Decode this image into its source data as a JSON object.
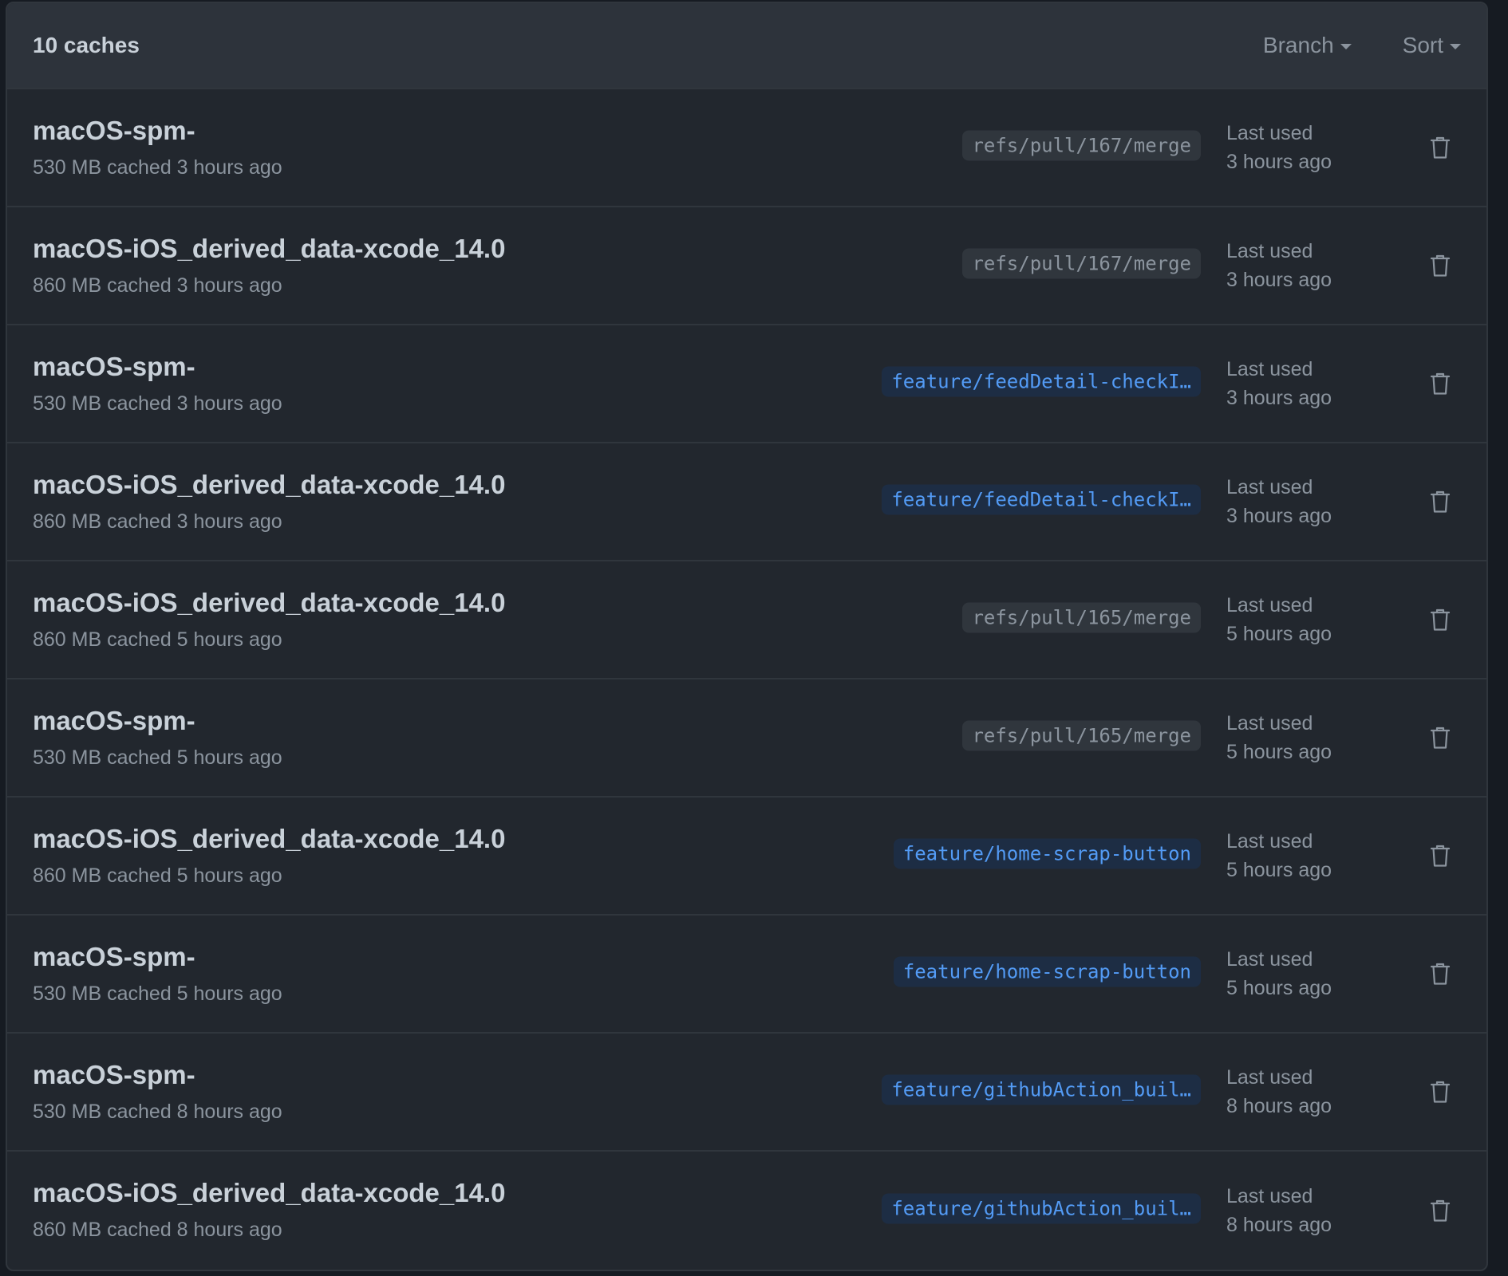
{
  "header": {
    "count_label": "10 caches",
    "branch_filter": "Branch",
    "sort_filter": "Sort"
  },
  "colors": {
    "background": "#22272e",
    "header_bg": "#2d333b",
    "border": "#30363d",
    "primary_text": "#c9d1d9",
    "muted_text": "#8b949e",
    "feature_branch_text": "#539bf5",
    "feature_branch_bg": "#1d2d44",
    "ref_branch_bg": "#30363d"
  },
  "caches": [
    {
      "key": "macOS-spm-",
      "meta": "530 MB cached 3 hours ago",
      "branch": "refs/pull/167/merge",
      "branch_kind": "ref",
      "last_used_label": "Last used",
      "last_used": "3 hours ago",
      "delete_icon": "trash-icon"
    },
    {
      "key": "macOS-iOS_derived_data-xcode_14.0",
      "meta": "860 MB cached 3 hours ago",
      "branch": "refs/pull/167/merge",
      "branch_kind": "ref",
      "last_used_label": "Last used",
      "last_used": "3 hours ago",
      "delete_icon": "trash-icon"
    },
    {
      "key": "macOS-spm-",
      "meta": "530 MB cached 3 hours ago",
      "branch": "feature/feedDetail-checkI…",
      "branch_kind": "feature",
      "last_used_label": "Last used",
      "last_used": "3 hours ago",
      "delete_icon": "trash-icon"
    },
    {
      "key": "macOS-iOS_derived_data-xcode_14.0",
      "meta": "860 MB cached 3 hours ago",
      "branch": "feature/feedDetail-checkI…",
      "branch_kind": "feature",
      "last_used_label": "Last used",
      "last_used": "3 hours ago",
      "delete_icon": "trash-icon"
    },
    {
      "key": "macOS-iOS_derived_data-xcode_14.0",
      "meta": "860 MB cached 5 hours ago",
      "branch": "refs/pull/165/merge",
      "branch_kind": "ref",
      "last_used_label": "Last used",
      "last_used": "5 hours ago",
      "delete_icon": "trash-icon"
    },
    {
      "key": "macOS-spm-",
      "meta": "530 MB cached 5 hours ago",
      "branch": "refs/pull/165/merge",
      "branch_kind": "ref",
      "last_used_label": "Last used",
      "last_used": "5 hours ago",
      "delete_icon": "trash-icon"
    },
    {
      "key": "macOS-iOS_derived_data-xcode_14.0",
      "meta": "860 MB cached 5 hours ago",
      "branch": "feature/home-scrap-button",
      "branch_kind": "feature",
      "last_used_label": "Last used",
      "last_used": "5 hours ago",
      "delete_icon": "trash-icon"
    },
    {
      "key": "macOS-spm-",
      "meta": "530 MB cached 5 hours ago",
      "branch": "feature/home-scrap-button",
      "branch_kind": "feature",
      "last_used_label": "Last used",
      "last_used": "5 hours ago",
      "delete_icon": "trash-icon"
    },
    {
      "key": "macOS-spm-",
      "meta": "530 MB cached 8 hours ago",
      "branch": "feature/githubAction_buil…",
      "branch_kind": "feature",
      "last_used_label": "Last used",
      "last_used": "8 hours ago",
      "delete_icon": "trash-icon"
    },
    {
      "key": "macOS-iOS_derived_data-xcode_14.0",
      "meta": "860 MB cached 8 hours ago",
      "branch": "feature/githubAction_buil…",
      "branch_kind": "feature",
      "last_used_label": "Last used",
      "last_used": "8 hours ago",
      "delete_icon": "trash-icon"
    }
  ]
}
